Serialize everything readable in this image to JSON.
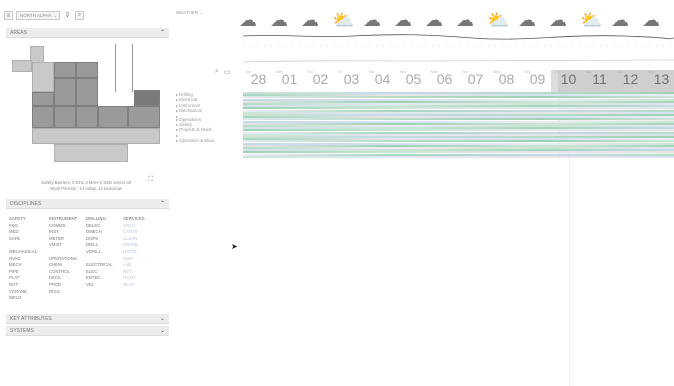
{
  "header": {
    "site": "NORTH ALPHA",
    "menu_icon": "hamburger-icon",
    "filter_icon": "funnel-icon",
    "search_icon": "search-icon"
  },
  "sections": {
    "areas": "AREAS",
    "disciplines": "DISCIPLINES",
    "key_attributes": "KEY ATTRIBUTES",
    "systems": "SYSTEMS"
  },
  "area_list": [
    "Drilling",
    "Electrical",
    "Instrument",
    "Mechanical",
    "Operations",
    "Safety",
    "Projects & Mods",
    "Operation & Main."
  ],
  "safety": {
    "line1": "Safety Barriers: 0 DHL   0 MAH   0 SSD   Select all",
    "line2": "Work Permits : 14 today, 14 tomorrow"
  },
  "disciplines": {
    "columns": [
      [
        "SAFETY",
        "F&G",
        "MED",
        "SAFE",
        "",
        "MECHANICAL",
        "HVAC",
        "MECH",
        "PIPE",
        "PLAT",
        "ROT",
        "VCRANE",
        "WELD"
      ],
      [
        "INSTRUMENT",
        "COMMS",
        "INST",
        "METER",
        "VMIST",
        "",
        "OPERATIONS",
        "CHEM",
        "CONTROL",
        "DECK",
        "PROD",
        "RIGG",
        ""
      ],
      [
        "DRILLING",
        "DELEC",
        "DMECH",
        "DOPS",
        "DRILL",
        "VDRILL",
        "",
        "ELECTRICAL",
        "ELEC",
        "ENTEC",
        "VEL",
        ""
      ],
      [
        "SERVICES",
        "ARCH",
        "CATER",
        "CLEAN",
        "CRANE",
        "HOTEL",
        "INSP",
        "LAB",
        "RET",
        "PAINT",
        "SCAF"
      ]
    ],
    "faint_rows": [
      1,
      2,
      3,
      4,
      5,
      6,
      7,
      8,
      9
    ]
  },
  "weather": {
    "label": "WEATHER"
  },
  "days": [
    {
      "num": "28",
      "dow": "Tue"
    },
    {
      "num": "01",
      "dow": "Wed"
    },
    {
      "num": "02",
      "dow": "Thu"
    },
    {
      "num": "03",
      "dow": "Fri"
    },
    {
      "num": "04",
      "dow": "Sat"
    },
    {
      "num": "05",
      "dow": "Sun"
    },
    {
      "num": "06",
      "dow": "Mon"
    },
    {
      "num": "07",
      "dow": "Tue"
    },
    {
      "num": "08",
      "dow": "Wed"
    },
    {
      "num": "09",
      "dow": "Thu"
    },
    {
      "num": "10",
      "dow": "Fri"
    },
    {
      "num": "11",
      "dow": "Sat"
    },
    {
      "num": "12",
      "dow": "Sun"
    },
    {
      "num": "13",
      "dow": "Mon"
    }
  ],
  "week_labels": {
    "w9": "9",
    "w10": "10",
    "w11": "11"
  }
}
